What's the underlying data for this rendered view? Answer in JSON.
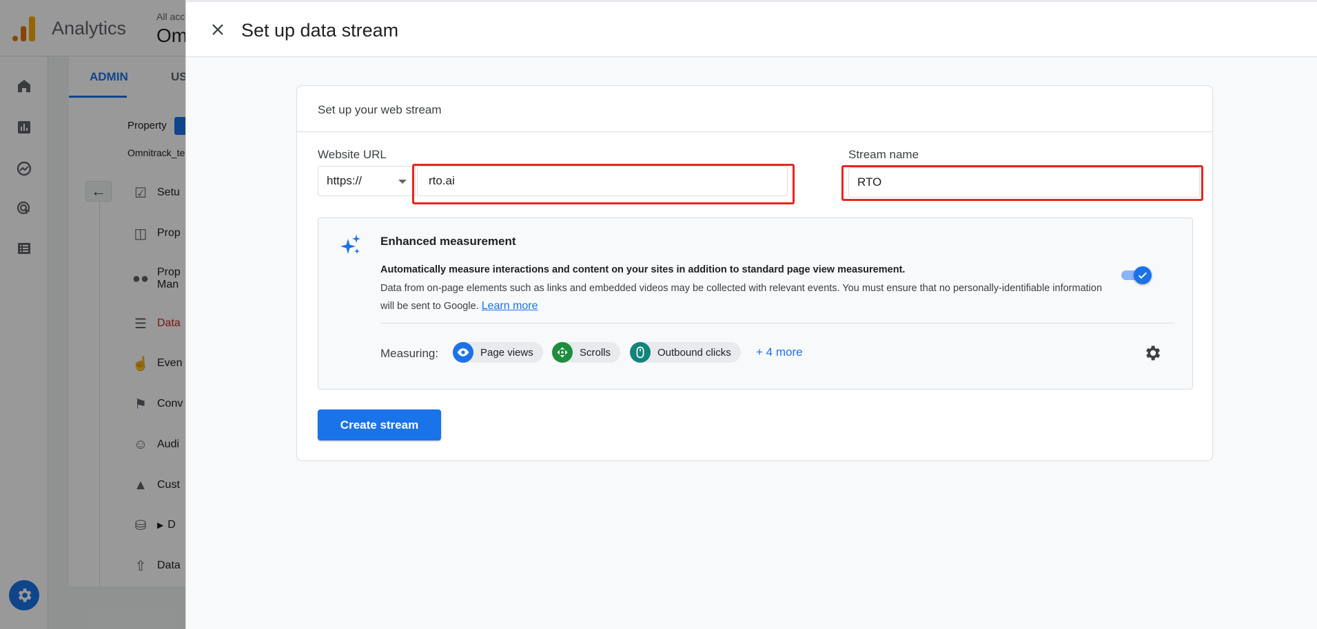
{
  "app": {
    "name": "Analytics",
    "account_small": "All acc",
    "account_big": "Om"
  },
  "admin_tabs": {
    "admin": "ADMIN",
    "user": "US"
  },
  "property": {
    "label": "Property",
    "name": "Omnitrack_te"
  },
  "side_menu": [
    {
      "label": "Setu",
      "icon": "checklist-icon"
    },
    {
      "label": "Prop",
      "icon": "layout-icon"
    },
    {
      "label": "Prop\nMan",
      "icon": "people-icon"
    },
    {
      "label": "Data",
      "icon": "data-streams-icon",
      "active": true
    },
    {
      "label": "Even",
      "icon": "touch-icon"
    },
    {
      "label": "Conv",
      "icon": "flag-icon"
    },
    {
      "label": "Audi",
      "icon": "audience-icon"
    },
    {
      "label": "Cust",
      "icon": "shapes-icon"
    },
    {
      "label": "D",
      "icon": "database-icon"
    },
    {
      "label": "Data",
      "icon": "upload-icon"
    }
  ],
  "dialog": {
    "title": "Set up data stream",
    "card_title": "Set up your web stream",
    "website_url_label": "Website URL",
    "scheme": "https://",
    "url_value": "rto.ai",
    "stream_name_label": "Stream name",
    "stream_name_value": "RTO",
    "enhanced": {
      "title": "Enhanced measurement",
      "bold_text": "Automatically measure interactions and content on your sites in addition to standard page view measurement.",
      "body_text": "Data from on-page elements such as links and embedded videos may be collected with relevant events. You must ensure that no personally-identifiable information will be sent to Google.",
      "learn_more": "Learn more",
      "enabled": true,
      "measuring_label": "Measuring:",
      "chips": [
        {
          "label": "Page views",
          "icon": "eye-icon",
          "color": "#1a73e8"
        },
        {
          "label": "Scrolls",
          "icon": "scroll-icon",
          "color": "#1e8e3e"
        },
        {
          "label": "Outbound clicks",
          "icon": "mouse-icon",
          "color": "#12857a"
        }
      ],
      "more": "+ 4 more"
    },
    "create_button": "Create stream"
  },
  "colors": {
    "primary": "#1a73e8",
    "highlight": "#e8251d",
    "active_menu": "#c5221f"
  }
}
